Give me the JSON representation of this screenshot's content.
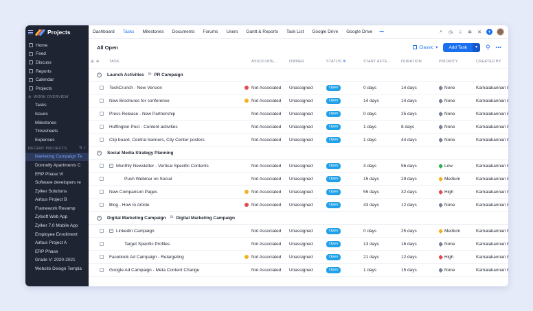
{
  "app": {
    "name": "Projects"
  },
  "sidebar": {
    "nav": [
      {
        "label": "Home",
        "icon": "home-icon"
      },
      {
        "label": "Feed",
        "icon": "feed-icon"
      },
      {
        "label": "Discuss",
        "icon": "discuss-icon"
      },
      {
        "label": "Reports",
        "icon": "reports-icon"
      },
      {
        "label": "Calendar",
        "icon": "calendar-icon"
      },
      {
        "label": "Projects",
        "icon": "projects-icon"
      }
    ],
    "work_overview_label": "WORK OVERVIEW",
    "work_items": [
      "Tasks",
      "Issues",
      "Milestones",
      "Timesheets",
      "Expenses"
    ],
    "recent_projects_label": "RECENT PROJECTS",
    "recent_projects": [
      "Marketing Campaign Te",
      "Donnelly Apartments C",
      "ERP Phase VI",
      "Software developers re",
      "Zylker Solutions",
      "Airbus Project B",
      "Framework Revamp",
      "Zylsoft Web App",
      "Zylker 7.0 Mobile App",
      "Employee Enrollment",
      "Airbus Project A",
      "ERP Phase",
      "Grade V: 2020-2021",
      "Website Design Templa"
    ]
  },
  "topnav": {
    "tabs": [
      "Dashboard",
      "Tasks",
      "Milestones",
      "Documents",
      "Forums",
      "Users",
      "Gantt & Reports",
      "Task List",
      "Google Drive",
      "Google Drive"
    ],
    "active": "Tasks",
    "more": "•••"
  },
  "toolbar": {
    "title": "All Open",
    "view_label": "Classic",
    "add_task_label": "Add Task",
    "more": "•••"
  },
  "columns": {
    "task": "TASK",
    "associated": "ASSOCIATE...",
    "owner": "OWNER",
    "status": "STATUS",
    "start_after": "START AFTE...",
    "duration": "DURATION",
    "priority": "PRIORITY",
    "created_by": "CREATED BY"
  },
  "colors": {
    "accent": "#1a6ff0",
    "status_open": "#1fa0e8",
    "priority_none": "#7a8196",
    "priority_low": "#2bb24c",
    "priority_medium": "#f2b01e",
    "priority_high": "#e5484d",
    "flag_red": "#e5484d",
    "flag_yellow": "#f2b01e"
  },
  "groups": [
    {
      "name": "Launch Activities",
      "milestone": "PR Campaign",
      "rows": [
        {
          "task": "TechCrunch - New Version",
          "flag": "red",
          "assoc": "Not Associated",
          "owner": "Unassigned",
          "status": "Open",
          "start": "0 days",
          "duration": "14 days",
          "priority": "None",
          "by": "Kamalakannan B"
        },
        {
          "task": "New Brochures for conference",
          "flag": "yellow",
          "assoc": "Not Associated",
          "owner": "Unassigned",
          "status": "Open",
          "start": "14 days",
          "duration": "14 days",
          "priority": "None",
          "by": "Kamalakannan B"
        },
        {
          "task": "Press Release - New Partnership",
          "flag": "",
          "assoc": "Not Associated",
          "owner": "Unassigned",
          "status": "Open",
          "start": "0 days",
          "duration": "25 days",
          "priority": "None",
          "by": "Kamalakannan B"
        },
        {
          "task": "Huffington Post - Content activities",
          "flag": "",
          "assoc": "Not Associated",
          "owner": "Unassigned",
          "status": "Open",
          "start": "1 days",
          "duration": "8 days",
          "priority": "None",
          "by": "Kamalakannan B"
        },
        {
          "task": "Clip board, Central banners, City Center posters",
          "flag": "",
          "assoc": "Not Associated",
          "owner": "Unassigned",
          "status": "Open",
          "start": "1 days",
          "duration": "44 days",
          "priority": "None",
          "by": "Kamalakannan B"
        }
      ]
    },
    {
      "name": "Social Media Strategy Planning",
      "milestone": "",
      "rows": [
        {
          "task": "Monthly Newsletter - Vertical Specific Contents",
          "parent": true,
          "flag": "",
          "assoc": "Not Associated",
          "owner": "Unassigned",
          "status": "Open",
          "start": "3 days",
          "duration": "56 days",
          "priority": "Low",
          "by": "Kamalakannan B"
        },
        {
          "task": "Push Webinar on Social",
          "sub": true,
          "flag": "",
          "assoc": "Not Associated",
          "owner": "Unassigned",
          "status": "Open",
          "start": "15 days",
          "duration": "29 days",
          "priority": "Medium",
          "by": "Kamalakannan B"
        },
        {
          "task": "New Comparison Pages",
          "flag": "yellow",
          "assoc": "Not Associated",
          "owner": "Unassigned",
          "status": "Open",
          "start": "55 days",
          "duration": "32 days",
          "priority": "High",
          "by": "Kamalakannan B"
        },
        {
          "task": "Blog - How to Article",
          "flag": "red",
          "assoc": "Not Associated",
          "owner": "Unassigned",
          "status": "Open",
          "start": "43 days",
          "duration": "12 days",
          "priority": "None",
          "by": "Kamalakannan B"
        }
      ]
    },
    {
      "name": "Digital Marketing Campaign",
      "milestone": "Digital Marketing Campaign",
      "rows": [
        {
          "task": "Linkedin Campaign",
          "parent": true,
          "flag": "",
          "assoc": "Not Associated",
          "owner": "Unassigned",
          "status": "Open",
          "start": "0 days",
          "duration": "25 days",
          "priority": "Medium",
          "by": "Kamalakannan B"
        },
        {
          "task": "Target Specific Profiles",
          "sub": true,
          "flag": "",
          "assoc": "Not Associated",
          "owner": "Unassigned",
          "status": "Open",
          "start": "13 days",
          "duration": "16 days",
          "priority": "None",
          "by": "Kamalakannan B"
        },
        {
          "task": "Facebook Ad Campaign - Retargeting",
          "flag": "yellow",
          "assoc": "Not Associated",
          "owner": "Unassigned",
          "status": "Open",
          "start": "21 days",
          "duration": "12 days",
          "priority": "High",
          "by": "Kamalakannan B"
        },
        {
          "task": "Google Ad Campaign - Meta Content Change",
          "flag": "",
          "assoc": "Not Associated",
          "owner": "Unassigned",
          "status": "Open",
          "start": "1 days",
          "duration": "15 days",
          "priority": "None",
          "by": "Kamalakannan B"
        }
      ]
    }
  ]
}
